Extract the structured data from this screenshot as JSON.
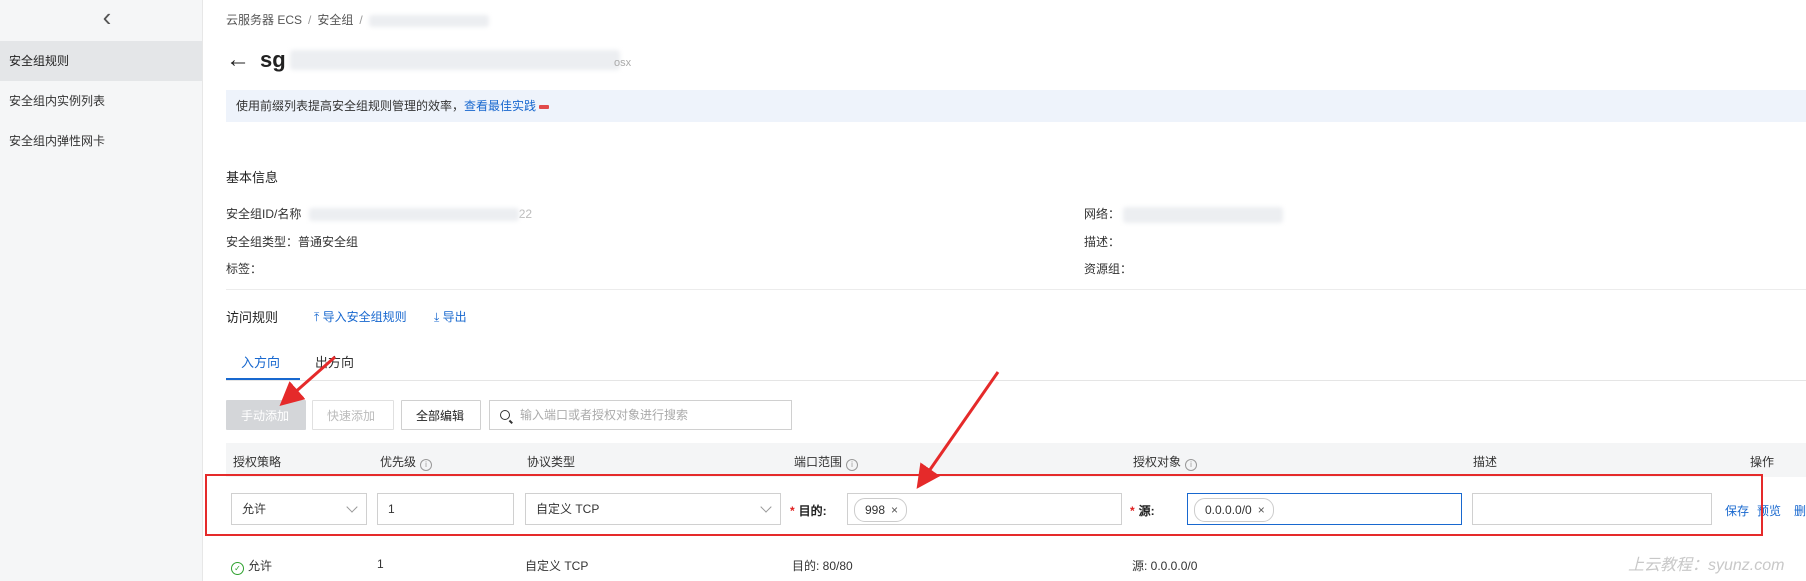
{
  "sidebar": {
    "collapse_icon": "chevron-left-icon",
    "items": [
      {
        "label": "安全组规则",
        "active": true
      },
      {
        "label": "安全组内实例列表",
        "active": false
      },
      {
        "label": "安全组内弹性网卡",
        "active": false
      }
    ]
  },
  "breadcrumb": {
    "items": [
      "云服务器 ECS",
      "安全组"
    ]
  },
  "header": {
    "back_icon": "arrow-left-icon",
    "title": "sg",
    "title_suffix": "osx"
  },
  "notice": {
    "text": "使用前缀列表提高安全组规则管理的效率，",
    "link": "查看最佳实践"
  },
  "basic_info": {
    "title": "基本信息",
    "id_label": "安全组ID/名称",
    "id_suffix": "22",
    "type_label": "安全组类型：",
    "type_value": "普通安全组",
    "tags_label": "标签：",
    "network_label": "网络：",
    "desc_label": "描述：",
    "resource_group_label": "资源组："
  },
  "access_rules": {
    "title": "访问规则",
    "import_label": "导入安全组规则",
    "export_label": "导出",
    "import_icon": "upload-icon",
    "export_icon": "download-icon"
  },
  "tabs": [
    {
      "label": "入方向",
      "active": true
    },
    {
      "label": "出方向",
      "active": false
    }
  ],
  "toolbar": {
    "manual_add": "手动添加",
    "quick_add": "快速添加",
    "edit_all": "全部编辑",
    "search_placeholder": "输入端口或者授权对象进行搜索"
  },
  "table": {
    "headers": [
      "授权策略",
      "优先级",
      "协议类型",
      "端口范围",
      "授权对象",
      "描述",
      "操作"
    ]
  },
  "edit_row": {
    "policy": "允许",
    "priority": "1",
    "protocol": "自定义 TCP",
    "dest_label": "目的:",
    "dest_chip": "998",
    "source_label": "源:",
    "source_chip": "0.0.0.0/0",
    "description": "",
    "save": "保存",
    "preview": "预览",
    "delete": "删"
  },
  "row2": {
    "policy": "允许",
    "priority": "1",
    "protocol": "自定义 TCP",
    "port": "目的: 80/80",
    "source": "源: 0.0.0.0/0"
  },
  "watermark": "上云教程：syunz.com",
  "colors": {
    "accent": "#1868cf",
    "highlight": "#e52a2a",
    "sidebar_bg": "#f5f6f7",
    "notice_bg": "#eef3fb"
  }
}
